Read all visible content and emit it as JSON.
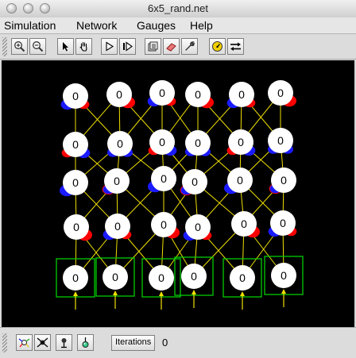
{
  "window": {
    "title": "6x5_rand.net"
  },
  "menu": [
    "Simulation",
    "Network",
    "Gauges",
    "Help"
  ],
  "toolbar": {
    "buttons": [
      {
        "name": "zoom-in-button",
        "icon": "zoom-in-icon"
      },
      {
        "name": "zoom-out-button",
        "icon": "zoom-out-icon"
      },
      {
        "name": "select-button",
        "icon": "arrow-pointer-icon"
      },
      {
        "name": "pan-button",
        "icon": "hand-icon"
      },
      {
        "name": "play-button",
        "icon": "play-icon"
      },
      {
        "name": "step-button",
        "icon": "step-icon"
      },
      {
        "name": "network-button",
        "icon": "network-icon"
      },
      {
        "name": "eraser-button",
        "icon": "eraser-icon"
      },
      {
        "name": "wrench-button",
        "icon": "wrench-icon"
      },
      {
        "name": "gauge-button",
        "icon": "gauge-icon"
      },
      {
        "name": "swap-button",
        "icon": "swap-arrows-icon"
      }
    ]
  },
  "network": {
    "rows": 5,
    "cols": 6,
    "node_value": "0",
    "colors": {
      "background": "#000000",
      "node": "#ffffff",
      "edge": "#f0e000",
      "positive": "#ff0000",
      "negative": "#1a1aff",
      "input_box": "#00cc00"
    }
  },
  "status": {
    "buttons": [
      {
        "name": "add-neuron-button",
        "icon": "neuron-add-icon"
      },
      {
        "name": "remove-neuron-button",
        "icon": "neuron-remove-icon"
      },
      {
        "name": "probe-button",
        "icon": "probe-icon"
      },
      {
        "name": "weight-button",
        "icon": "weight-icon"
      }
    ],
    "iterations_label": "Iterations",
    "iterations_value": "0"
  }
}
